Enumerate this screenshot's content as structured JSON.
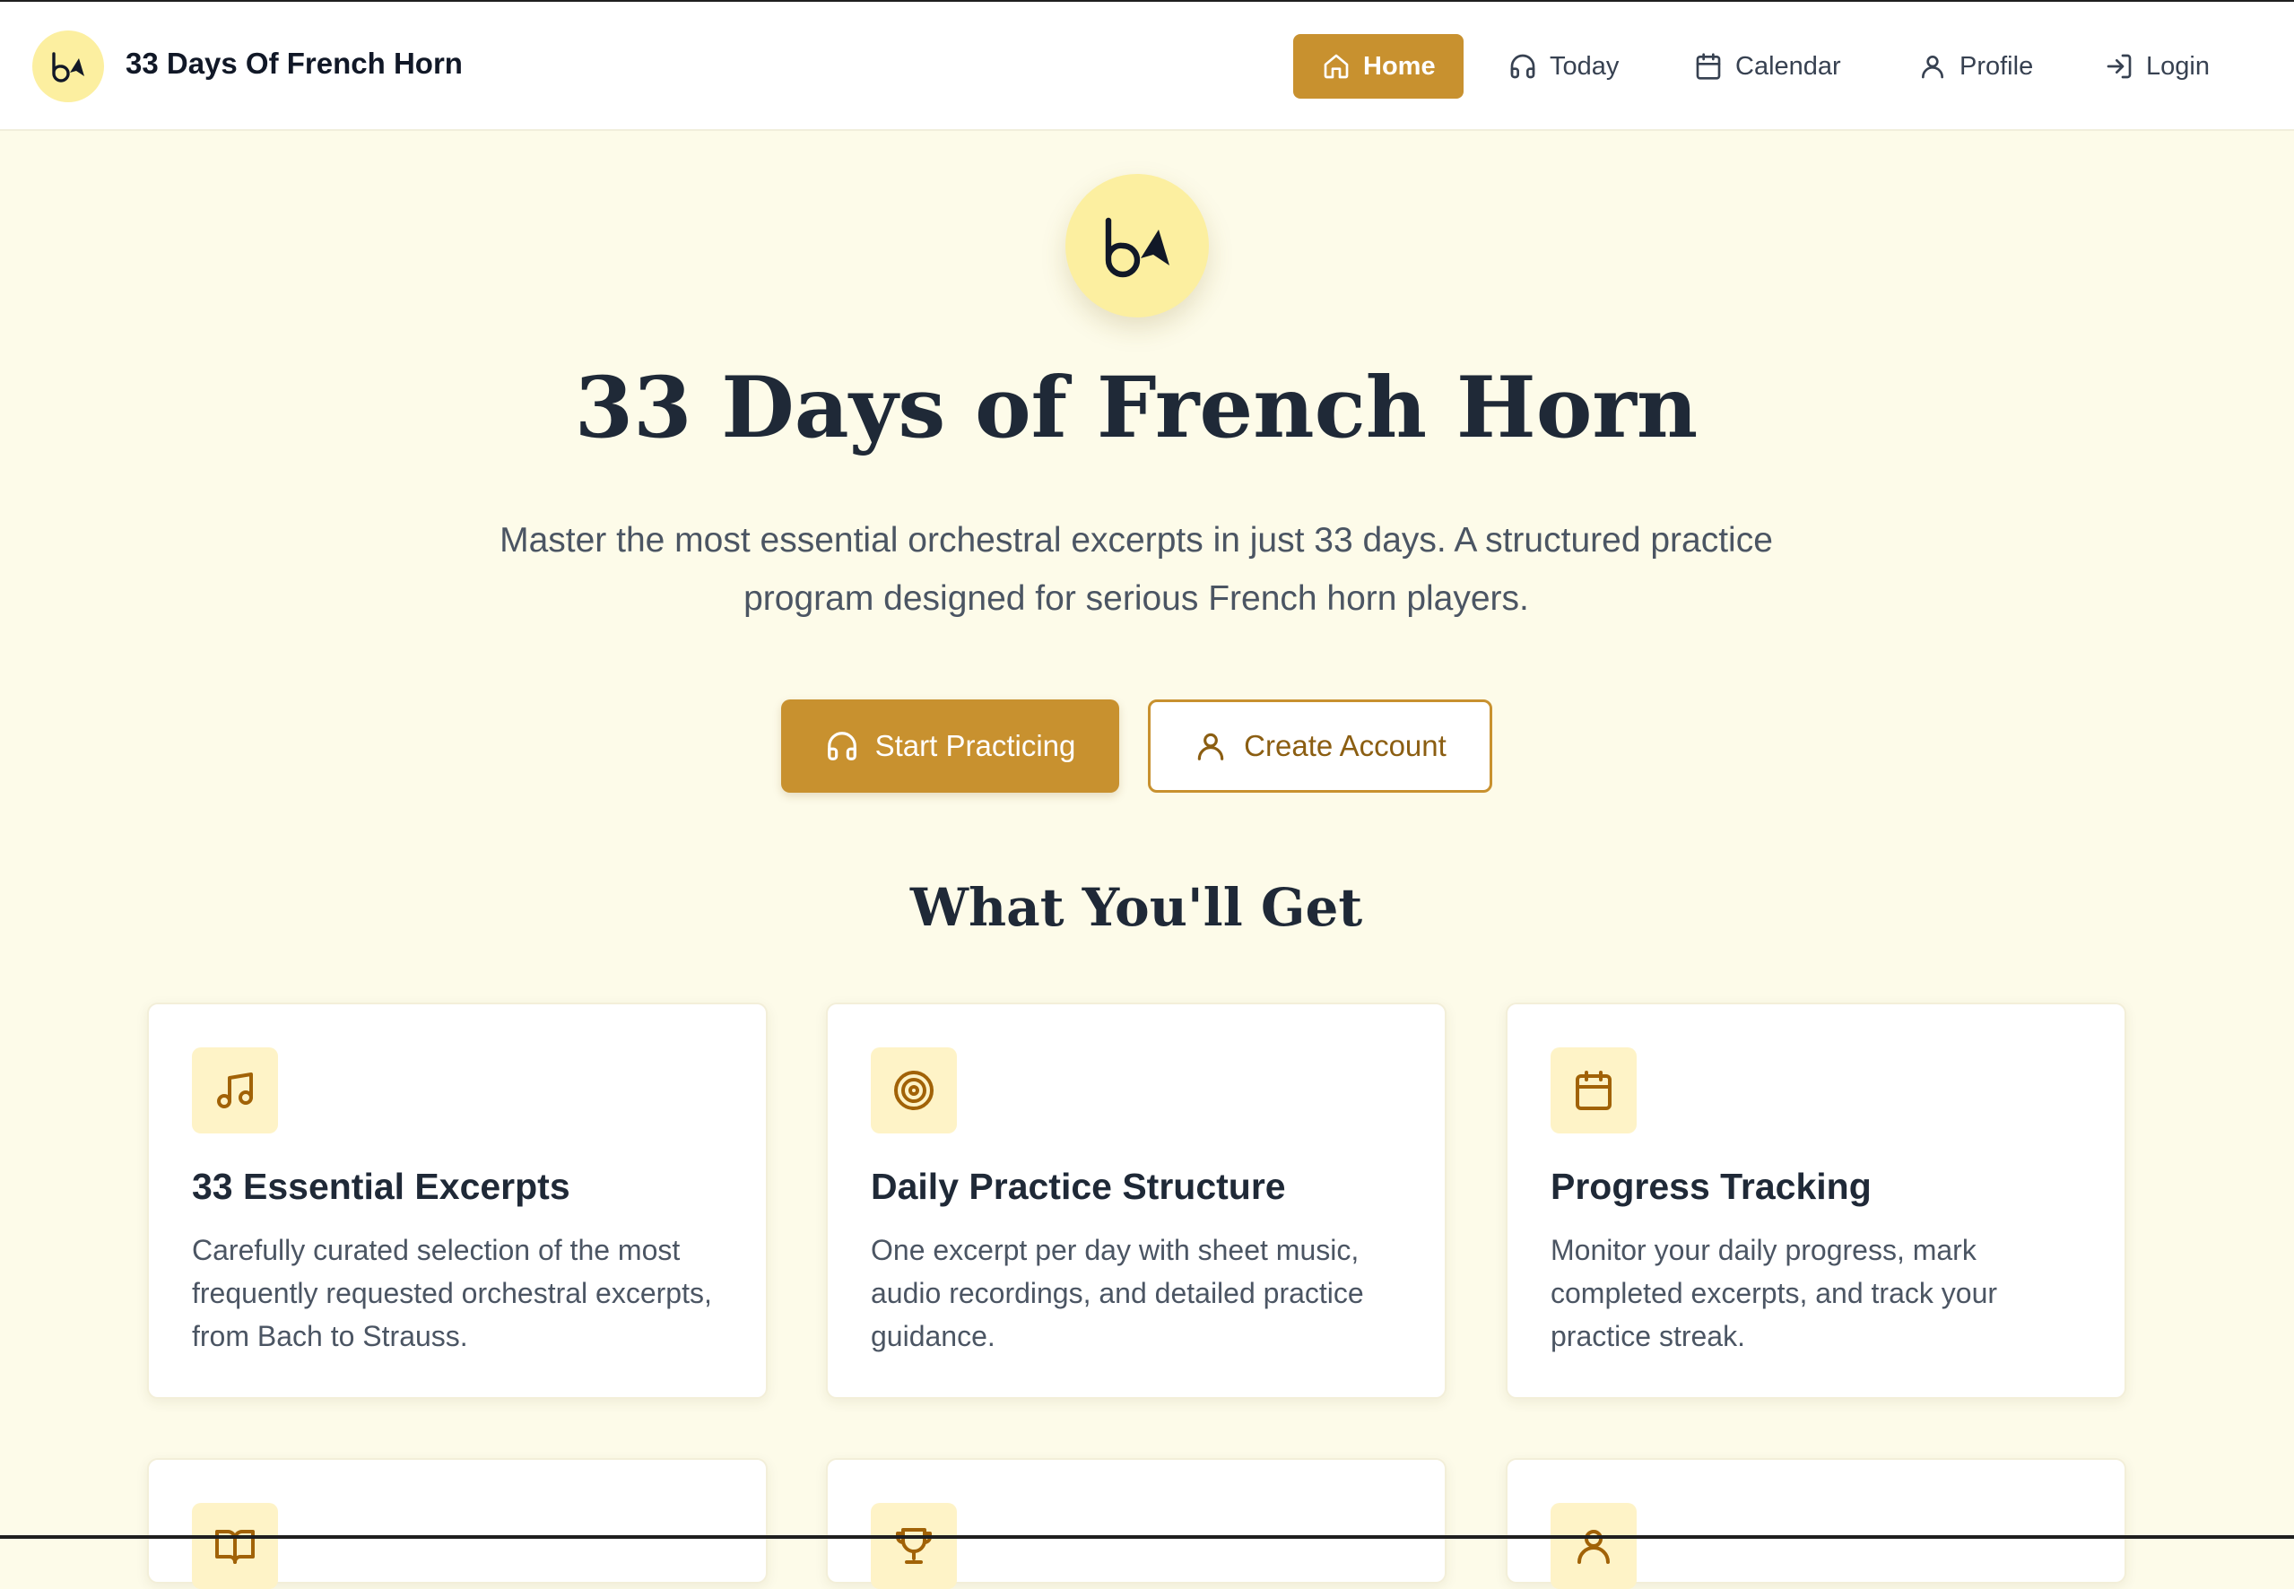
{
  "brand": {
    "title": "33 Days Of French Horn",
    "logo_icon": "french-horn-icon"
  },
  "nav": {
    "items": [
      {
        "label": "Home",
        "icon": "home-icon",
        "active": true
      },
      {
        "label": "Today",
        "icon": "headphones-icon",
        "active": false
      },
      {
        "label": "Calendar",
        "icon": "calendar-icon",
        "active": false
      },
      {
        "label": "Profile",
        "icon": "user-icon",
        "active": false
      },
      {
        "label": "Login",
        "icon": "login-icon",
        "active": false
      }
    ]
  },
  "hero": {
    "title": "33 Days of French Horn",
    "subtitle": "Master the most essential orchestral excerpts in just 33 days. A structured practice program designed for serious French horn players.",
    "primary_button": {
      "label": "Start Practicing",
      "icon": "headphones-icon"
    },
    "secondary_button": {
      "label": "Create Account",
      "icon": "user-icon"
    }
  },
  "features": {
    "title": "What You'll Get",
    "cards": [
      {
        "icon": "music-note-icon",
        "title": "33 Essential Excerpts",
        "description": "Carefully curated selection of the most frequently requested orchestral excerpts, from Bach to Strauss."
      },
      {
        "icon": "target-icon",
        "title": "Daily Practice Structure",
        "description": "One excerpt per day with sheet music, audio recordings, and detailed practice guidance."
      },
      {
        "icon": "calendar-icon",
        "title": "Progress Tracking",
        "description": "Monitor your daily progress, mark completed excerpts, and track your practice streak."
      },
      {
        "icon": "book-open-icon"
      },
      {
        "icon": "trophy-icon"
      },
      {
        "icon": "user-icon"
      }
    ]
  },
  "colors": {
    "accent": "#C8912F",
    "accent_dark": "#8B5E12",
    "page_background": "#FDFBE9",
    "logo_background": "#FCEFA0",
    "icon_tile": "#FEF3C7"
  }
}
